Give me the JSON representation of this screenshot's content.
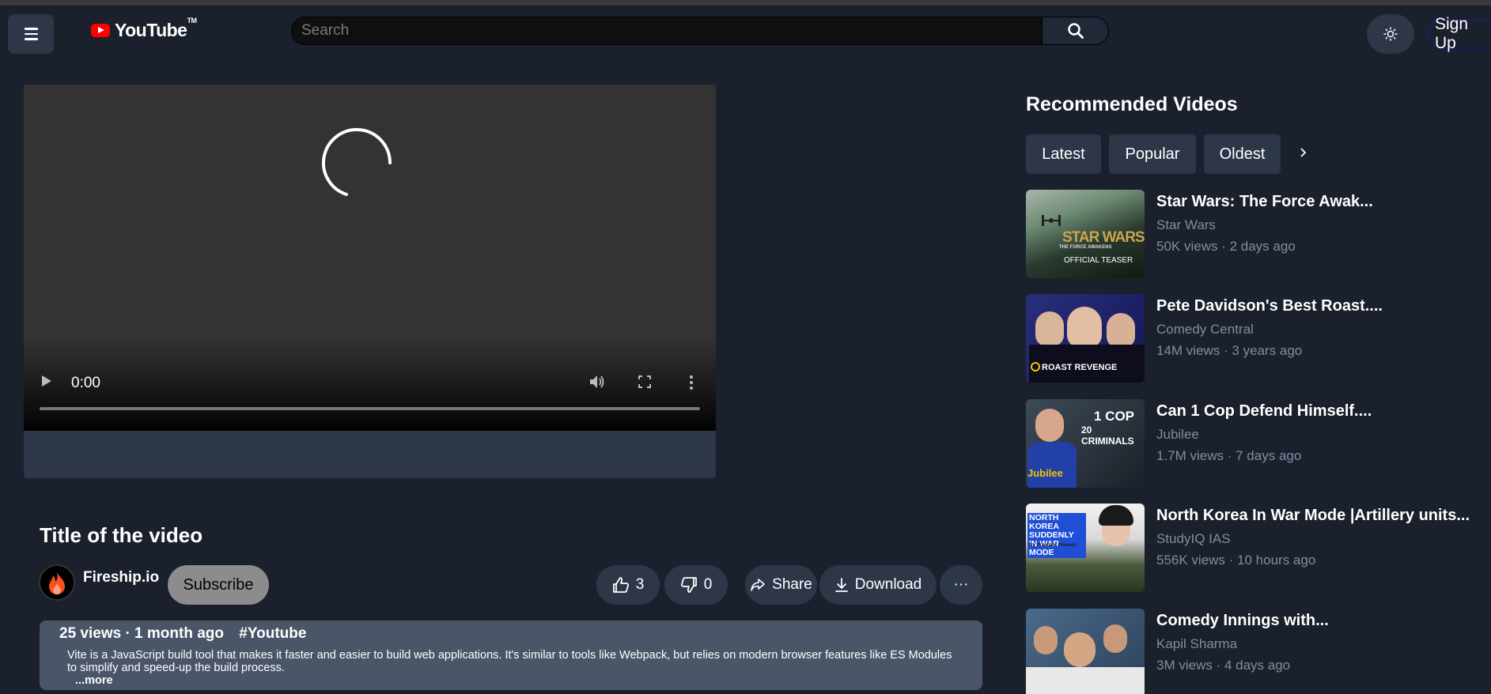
{
  "header": {
    "logo_text": "YouTube",
    "logo_tm": "TM",
    "search_placeholder": "Search",
    "signup_label": "Sign Up"
  },
  "player": {
    "time": "0:00"
  },
  "video": {
    "title": "Title of the video",
    "channel": "Fireship.io",
    "subscribe_label": "Subscribe",
    "likes": "3",
    "dislikes": "0",
    "share_label": "Share",
    "download_label": "Download",
    "more_label": "···",
    "views_age": "25 views · 1 month ago",
    "hashtag": "#Youtube",
    "description": "Vite is a JavaScript build tool that makes it faster and easier to build web applications. It's similar to tools like Webpack, but relies on modern browser features like ES Modules to simplify and speed-up the build process.",
    "more_link": "...more"
  },
  "sidebar": {
    "title": "Recommended Videos",
    "filters": [
      "Latest",
      "Popular",
      "Oldest"
    ],
    "items": [
      {
        "title": "Star Wars: The Force Awak...",
        "channel": "Star Wars",
        "meta": "50K views · 2 days ago",
        "thumb_text": "STAR WARS",
        "thumb_sub": "THE FORCE AWAKENS",
        "thumb_sub2": "OFFICIAL TEASER"
      },
      {
        "title": "Pete Davidson's Best Roast....",
        "channel": "Comedy Central",
        "meta": "14M views · 3 years ago",
        "thumb_text": "ROAST REVENGE"
      },
      {
        "title": "Can 1 Cop Defend Himself....",
        "channel": "Jubilee",
        "meta": "1.7M views · 7 days ago",
        "thumb_text": "1 COP",
        "thumb_sub": "20 CRIMINALS",
        "thumb_sub2": "Jubilee"
      },
      {
        "title": "North Korea In War Mode |Artillery units...",
        "channel": "StudyIQ IAS",
        "meta": "556K views · 10 hours ago",
        "thumb_text": "NORTH KOREA SUDDENLY IN WAR MODE",
        "thumb_sub": "By Prashant Dhawan"
      },
      {
        "title": "Comedy Innings with...",
        "channel": "Kapil Sharma",
        "meta": "3M views · 4 days ago"
      }
    ]
  },
  "colors": {
    "background": "#1a202c",
    "panel": "#2d3748",
    "description_bg": "#4a5568",
    "brand_red": "#ff0000",
    "muted_text": "#7f8ea3"
  }
}
